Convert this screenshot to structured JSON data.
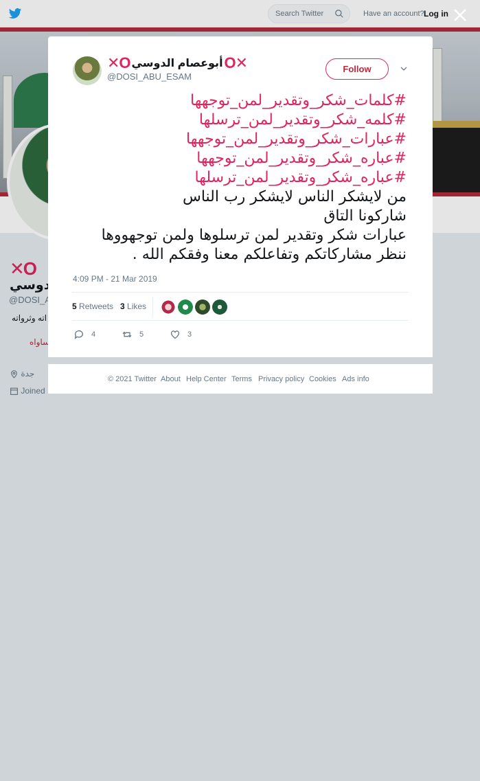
{
  "topbar": {
    "search_placeholder": "Search Twitter",
    "have_account": "Have an account?",
    "login": "Log in"
  },
  "background_profile": {
    "name": "الدوسي",
    "xo": "✕O",
    "handle": "@DOSI_A",
    "bio_line": "اته وثرواته",
    "bio_line2": "ساواه",
    "location": "جدة",
    "joined": "Joined"
  },
  "tweet": {
    "xo_left": "✕O",
    "xo_right": "O✕",
    "display_name": "أبوعصام الدوسي",
    "handle": "@DOSI_ABU_ESAM",
    "follow_label": "Follow",
    "hashtags": [
      "#كلمات_شكر_وتقدير_لمن_توجهها",
      "#كلمه_شكر_وتقدير_لمن_ترسلها",
      "#عبارات_شكر_وتقدير_لمن_توجهها",
      "#عباره_شكر_وتقدير_لمن_توجهها",
      "#عباره_شكر_وتقدير_لمن_ترسلها"
    ],
    "lines": [
      "من لايشكر الناس لايشكر رب الناس",
      "شاركونا التاق",
      "عبارات شكر وتقدير لمن ترسلوها ولمن توجهووها",
      "ننظر مشاركاتكم وتفاعلكم معنا وفقكم الله ."
    ],
    "timestamp": "4:09 PM - 21 Mar 2019",
    "retweets_count": "5",
    "retweets_label": "Retweets",
    "likes_count": "3",
    "likes_label": "Likes",
    "reply_count": "4",
    "retweet_action_count": "5",
    "like_action_count": "3"
  },
  "footer": {
    "copyright": "© 2021 Twitter",
    "about": "About",
    "help": "Help Center",
    "terms": "Terms",
    "privacy": "Privacy policy",
    "cookies": "Cookies",
    "ads": "Ads info"
  },
  "colors": {
    "accent": "#e0245e",
    "brand": "#1da1f2",
    "muted": "#657786"
  }
}
